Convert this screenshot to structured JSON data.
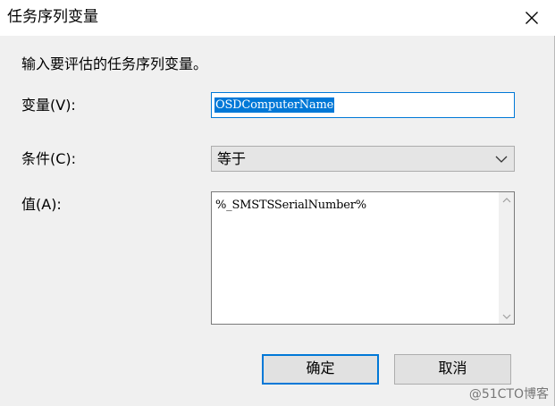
{
  "window": {
    "title": "任务序列变量",
    "close_icon": "close-icon"
  },
  "prompt": "输入要评估的任务序列变量。",
  "variable": {
    "label": "变量(V):",
    "value": "OSDComputerName"
  },
  "condition": {
    "label": "条件(C):",
    "selected": "等于",
    "chevron_icon": "chevron-down-icon"
  },
  "value_field": {
    "label": "值(A):",
    "value": "%_SMSTSSerialNumber%",
    "scroll_up_icon": "chevron-up-icon",
    "scroll_down_icon": "chevron-down-icon"
  },
  "buttons": {
    "ok": "确定",
    "cancel": "取消"
  },
  "watermark": "@51CTO博客",
  "colors": {
    "accent": "#0078d7",
    "dialog_bg": "#f0f0f0",
    "button_bg": "#e1e1e1",
    "select_bg": "#e5e5e5"
  }
}
